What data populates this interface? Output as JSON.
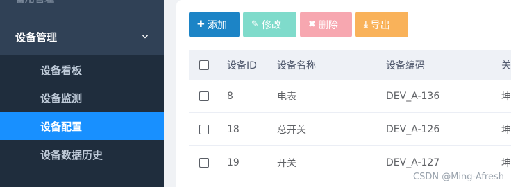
{
  "sidebar": {
    "clipped_top_label": "备用管理",
    "group_label": "设备管理",
    "items": [
      {
        "label": "设备看板",
        "active": false
      },
      {
        "label": "设备监测",
        "active": false
      },
      {
        "label": "设备配置",
        "active": true
      },
      {
        "label": "设备数据历史",
        "active": false
      }
    ]
  },
  "toolbar": {
    "add_label": "添加",
    "edit_label": "修改",
    "delete_label": "删除",
    "export_label": "导出"
  },
  "table": {
    "columns": [
      "设备ID",
      "设备名称",
      "设备编码",
      "关"
    ],
    "rows": [
      {
        "id": "8",
        "name": "电表",
        "code": "DEV_A-136",
        "more": "坤"
      },
      {
        "id": "18",
        "name": "总开关",
        "code": "DEV_A-126",
        "more": "坤"
      },
      {
        "id": "19",
        "name": "开关",
        "code": "DEV_A-127",
        "more": "坤"
      }
    ]
  },
  "watermark": "CSDN @Ming-Afresh",
  "colors": {
    "sidebar_bg": "#304156",
    "active_item": "#1890ff",
    "add_button": "#1c84c6",
    "edit_button": "#7fdbcb",
    "delete_button": "#f7a7b0",
    "export_button": "#f9b25a"
  }
}
